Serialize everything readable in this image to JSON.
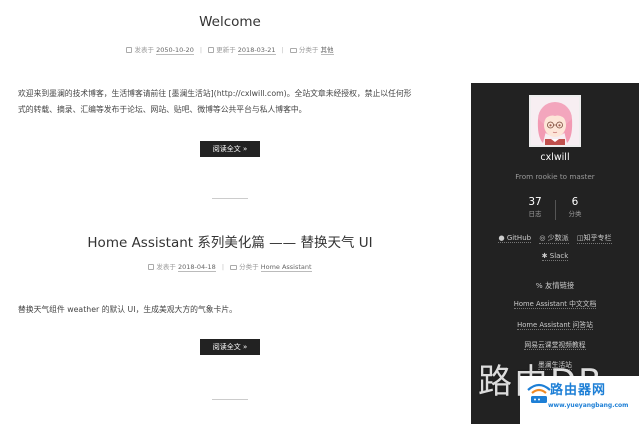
{
  "posts": [
    {
      "title": "Welcome",
      "posted_label": "发表于",
      "posted_date": "2050-10-20",
      "updated_label": "更新于",
      "updated_date": "2018-03-21",
      "category_label": "分类于",
      "category": "其他",
      "excerpt_line1": "欢迎来到墨澜的技术博客，生活博客请前往 [墨澜生活站](http://cxlwill.com)。全站文章未经授权，禁止以任何形",
      "excerpt_line2": "式的转载、摘录、汇编等发布于论坛、网站、贴吧、微博等公共平台与私人博客中。",
      "read_more": "阅读全文 »"
    },
    {
      "title": "Home Assistant 系列美化篇 —— 替换天气 UI",
      "posted_label": "发表于",
      "posted_date": "2018-04-18",
      "category_label": "分类于",
      "category": "Home Assistant",
      "excerpt_line1": "替换天气组件 weather 的默认 UI，生成美观大方的气象卡片。",
      "read_more": "阅读全文 »"
    }
  ],
  "sidebar": {
    "username": "cxlwill",
    "motto": "From rookie to master",
    "stats": [
      {
        "value": "37",
        "label": "日志"
      },
      {
        "value": "6",
        "label": "分类"
      }
    ],
    "social": [
      {
        "label": "GitHub",
        "icon": "github-icon"
      },
      {
        "label": "少数派",
        "icon": "sspai-icon"
      },
      {
        "label": "知乎专栏",
        "icon": "zhihu-icon"
      },
      {
        "label": "Slack",
        "icon": "slack-icon"
      }
    ],
    "links_title": "友情链接",
    "links": [
      "Home Assistant 中文文档",
      "Home Assistant 问答站",
      "网易云课堂视频教程",
      "墨澜生活站"
    ]
  },
  "watermark": {
    "big_text": "路由DB",
    "name": "路由器网",
    "url": "www.yueyangbang.com"
  },
  "colors": {
    "sidebar_bg": "#222222",
    "button_bg": "#222222",
    "watermark_blue": "#1d7fd6"
  }
}
